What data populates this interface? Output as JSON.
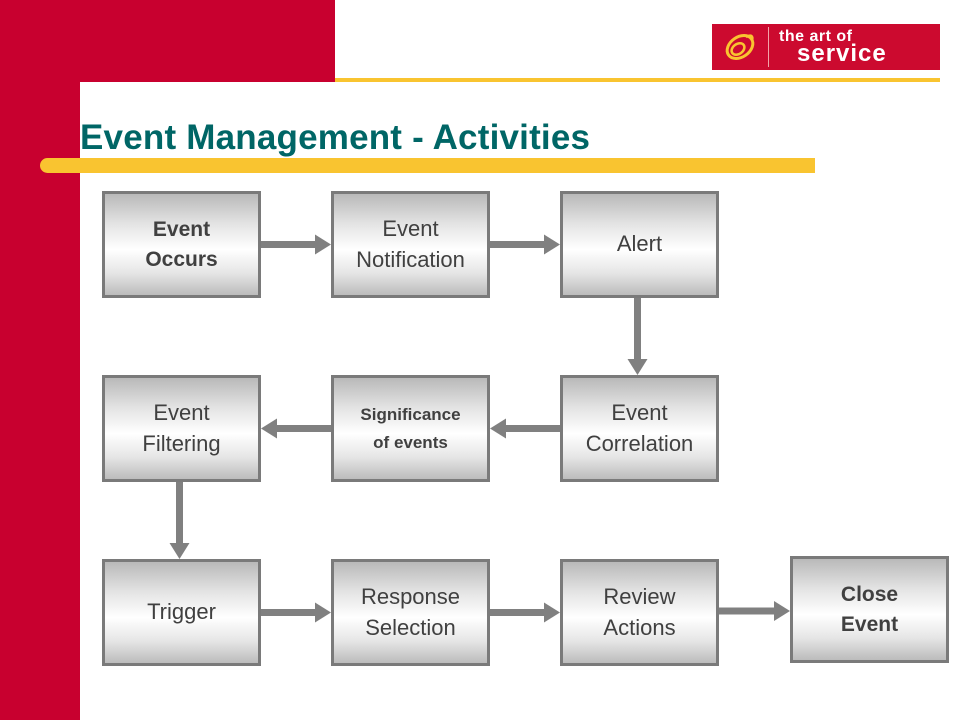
{
  "slide": {
    "title": "Event Management - Activities",
    "logo": {
      "line1": "the art of",
      "line2": "service"
    }
  },
  "colors": {
    "brand_red": "#c8002f",
    "accent_yellow": "#f9c430",
    "title_teal": "#006666",
    "box_border": "#7a7a7a",
    "arrow_gray": "#808080"
  },
  "diagram": {
    "nodes": [
      {
        "id": "event-occurs",
        "label": "Event\nOccurs",
        "style": "bold"
      },
      {
        "id": "event-notification",
        "label": "Event\nNotification",
        "style": "normal"
      },
      {
        "id": "alert",
        "label": "Alert",
        "style": "normal"
      },
      {
        "id": "event-correlation",
        "label": "Event\nCorrelation",
        "style": "normal"
      },
      {
        "id": "significance-of-events",
        "label": "Significance\nof events",
        "style": "small-bold"
      },
      {
        "id": "event-filtering",
        "label": "Event\nFiltering",
        "style": "normal"
      },
      {
        "id": "trigger",
        "label": "Trigger",
        "style": "normal"
      },
      {
        "id": "response-selection",
        "label": "Response\nSelection",
        "style": "normal"
      },
      {
        "id": "review-actions",
        "label": "Review\nActions",
        "style": "normal"
      },
      {
        "id": "close-event",
        "label": "Close\nEvent",
        "style": "bold"
      }
    ],
    "edges": [
      {
        "from": "event-occurs",
        "to": "event-notification"
      },
      {
        "from": "event-notification",
        "to": "alert"
      },
      {
        "from": "alert",
        "to": "event-correlation"
      },
      {
        "from": "event-correlation",
        "to": "significance-of-events"
      },
      {
        "from": "significance-of-events",
        "to": "event-filtering"
      },
      {
        "from": "event-filtering",
        "to": "trigger"
      },
      {
        "from": "trigger",
        "to": "response-selection"
      },
      {
        "from": "response-selection",
        "to": "review-actions"
      },
      {
        "from": "review-actions",
        "to": "close-event"
      }
    ]
  }
}
